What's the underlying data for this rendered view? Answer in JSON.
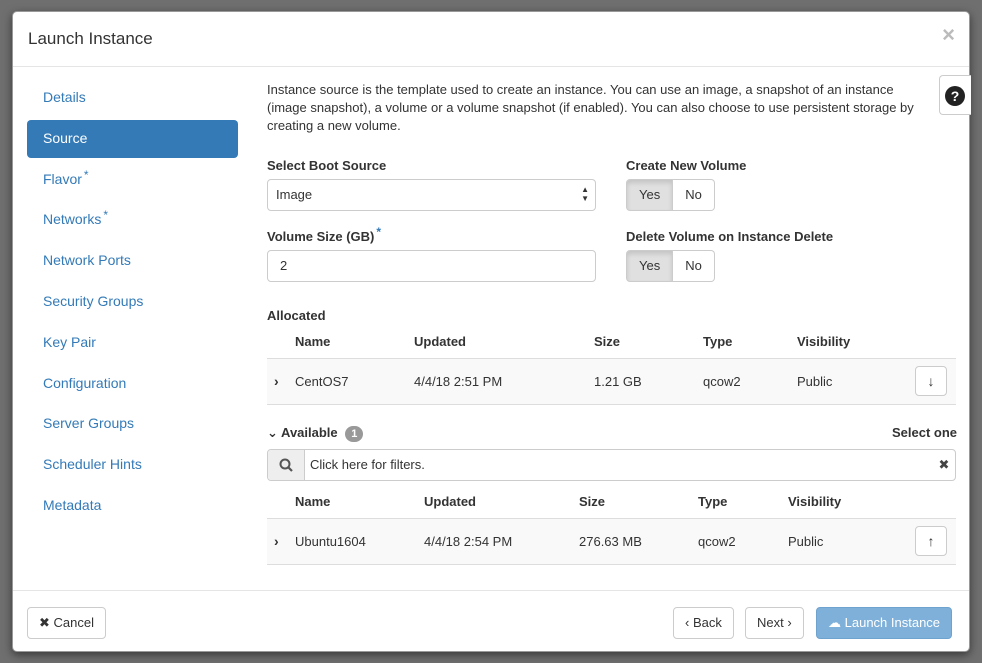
{
  "modal": {
    "title": "Launch Instance",
    "close_glyph": "×"
  },
  "sidebar": {
    "items": [
      {
        "label": "Details",
        "required": false
      },
      {
        "label": "Source",
        "required": false,
        "active": true
      },
      {
        "label": "Flavor",
        "required": true
      },
      {
        "label": "Networks",
        "required": true
      },
      {
        "label": "Network Ports",
        "required": false
      },
      {
        "label": "Security Groups",
        "required": false
      },
      {
        "label": "Key Pair",
        "required": false
      },
      {
        "label": "Configuration",
        "required": false
      },
      {
        "label": "Server Groups",
        "required": false
      },
      {
        "label": "Scheduler Hints",
        "required": false
      },
      {
        "label": "Metadata",
        "required": false
      }
    ],
    "required_mark": "*"
  },
  "source": {
    "intro": "Instance source is the template used to create an instance. You can use an image, a snapshot of an instance (image snapshot), a volume or a volume snapshot (if enabled). You can also choose to use persistent storage by creating a new volume.",
    "help_glyph": "?",
    "boot_source_label": "Select Boot Source",
    "boot_source_value": "Image",
    "create_volume_label": "Create New Volume",
    "create_volume_yes": "Yes",
    "create_volume_no": "No",
    "volume_size_label": "Volume Size (GB)",
    "volume_size_required": "*",
    "volume_size_value": "2",
    "delete_volume_label": "Delete Volume on Instance Delete",
    "delete_volume_yes": "Yes",
    "delete_volume_no": "No"
  },
  "allocated": {
    "title": "Allocated",
    "columns": [
      "Name",
      "Updated",
      "Size",
      "Type",
      "Visibility"
    ],
    "rows": [
      {
        "name": "CentOS7",
        "updated": "4/4/18 2:51 PM",
        "size": "1.21 GB",
        "type": "qcow2",
        "visibility": "Public"
      }
    ]
  },
  "available": {
    "title": "Available",
    "count": "1",
    "select_hint": "Select one",
    "filter_placeholder": "Click here for filters.",
    "columns": [
      "Name",
      "Updated",
      "Size",
      "Type",
      "Visibility"
    ],
    "rows": [
      {
        "name": "Ubuntu1604",
        "updated": "4/4/18 2:54 PM",
        "size": "276.63 MB",
        "type": "qcow2",
        "visibility": "Public"
      }
    ]
  },
  "footer": {
    "cancel": "Cancel",
    "back": "Back",
    "next": "Next",
    "launch": "Launch Instance"
  },
  "colors": {
    "accent": "#337ab7",
    "launch_disabled": "#7fb0d9",
    "backdrop": "#6f6f6f"
  }
}
